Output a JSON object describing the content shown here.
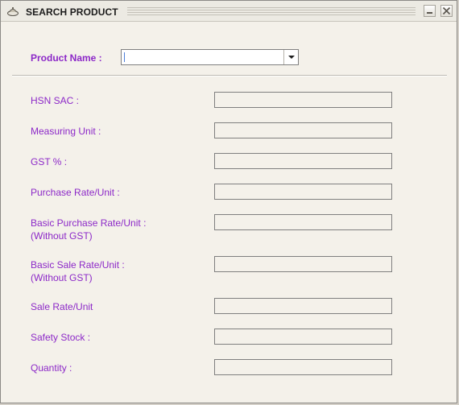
{
  "window": {
    "title": "SEARCH PRODUCT",
    "icon": "app-icon",
    "controls": [
      "minimize-icon",
      "close-icon"
    ]
  },
  "product_name": {
    "label": "Product Name :",
    "value": ""
  },
  "fields": {
    "hsn_sac": {
      "label": "HSN SAC :",
      "value": ""
    },
    "measuring_unit": {
      "label": "Measuring Unit :",
      "value": ""
    },
    "gst_percent": {
      "label": "GST % :",
      "value": ""
    },
    "purchase_rate": {
      "label": "Purchase Rate/Unit :",
      "value": ""
    },
    "basic_purchase_rate": {
      "label": "Basic Purchase Rate/Unit :",
      "sublabel": "(Without GST)",
      "value": ""
    },
    "basic_sale_rate": {
      "label": "Basic Sale Rate/Unit :",
      "sublabel": "(Without GST)",
      "value": ""
    },
    "sale_rate": {
      "label": "Sale Rate/Unit",
      "value": ""
    },
    "safety_stock": {
      "label": "Safety Stock :",
      "value": ""
    },
    "quantity": {
      "label": "Quantity :",
      "value": ""
    }
  },
  "colors": {
    "label": "#8c28c8",
    "window_bg": "#f4f1ea",
    "title_bg": "#eceae3"
  }
}
